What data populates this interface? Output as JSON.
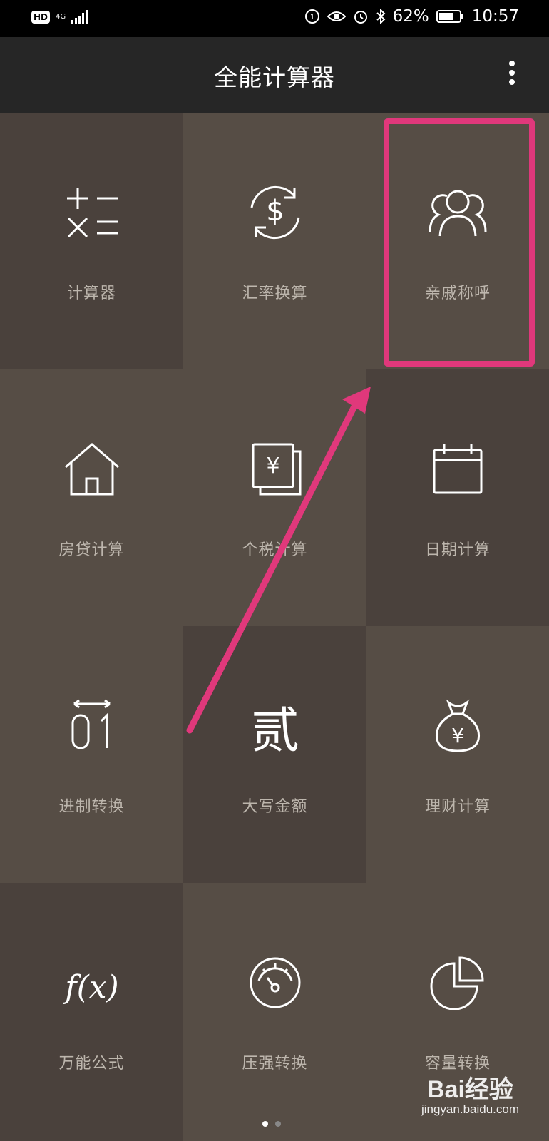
{
  "status_bar": {
    "hd": "HD",
    "network": "4G",
    "battery": "62%",
    "time": "10:57"
  },
  "app_bar": {
    "title": "全能计算器"
  },
  "tiles": [
    {
      "label": "计算器",
      "icon": "calculator-icon"
    },
    {
      "label": "汇率换算",
      "icon": "currency-exchange-icon"
    },
    {
      "label": "亲戚称呼",
      "icon": "relatives-icon"
    },
    {
      "label": "房贷计算",
      "icon": "house-icon"
    },
    {
      "label": "个税计算",
      "icon": "tax-document-icon"
    },
    {
      "label": "日期计算",
      "icon": "calendar-icon"
    },
    {
      "label": "进制转换",
      "icon": "binary-icon"
    },
    {
      "label": "大写金额",
      "icon": "chinese-numeral-icon"
    },
    {
      "label": "理财计算",
      "icon": "money-bag-icon"
    },
    {
      "label": "万能公式",
      "icon": "function-icon"
    },
    {
      "label": "压强转换",
      "icon": "gauge-icon"
    },
    {
      "label": "容量转换",
      "icon": "pie-chart-icon"
    }
  ],
  "pager": {
    "pages": 2,
    "current": 1
  },
  "watermark": {
    "brand": "Bai经验",
    "url": "jingyan.baidu.com"
  },
  "colors": {
    "accent": "#e0387b",
    "tile_dark": "#4a413c",
    "tile_light": "#564d45"
  }
}
